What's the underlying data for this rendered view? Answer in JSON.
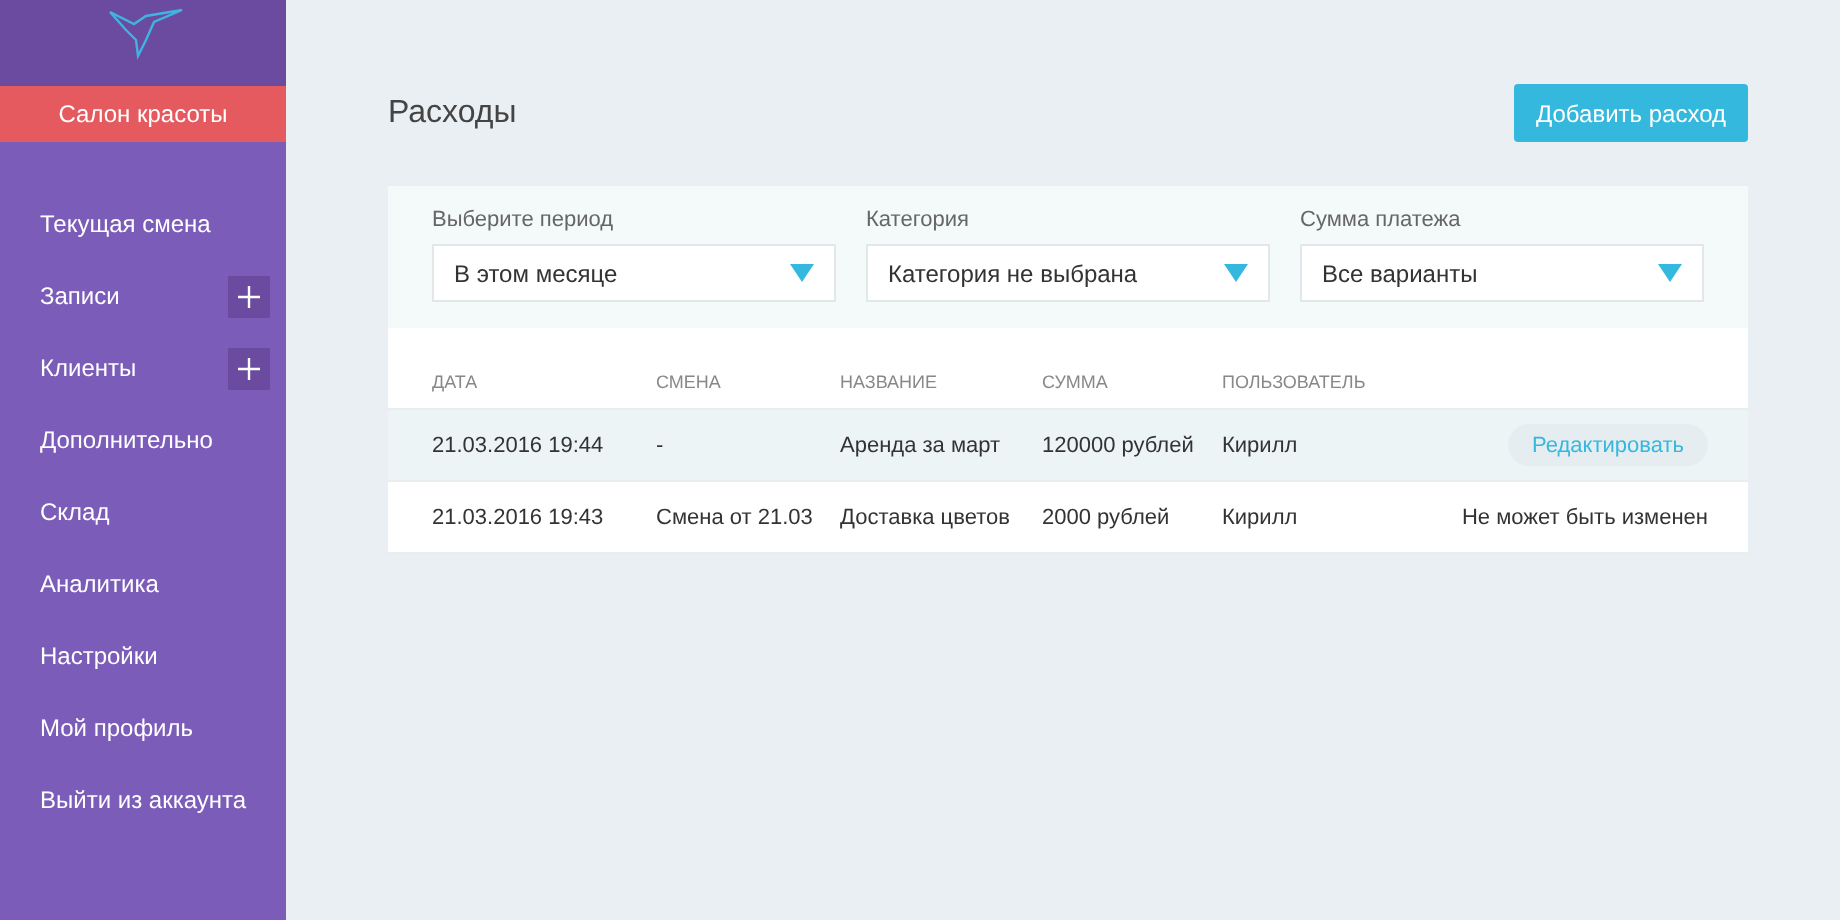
{
  "sidebar": {
    "brand": "Салон красоты",
    "items": [
      {
        "label": "Текущая смена",
        "kind": "link"
      },
      {
        "label": "Записи",
        "kind": "addable"
      },
      {
        "label": "Клиенты",
        "kind": "addable"
      },
      {
        "label": "Дополнительно",
        "kind": "link"
      },
      {
        "label": "Склад",
        "kind": "link"
      },
      {
        "label": "Аналитика",
        "kind": "link"
      },
      {
        "label": "Настройки",
        "kind": "link"
      },
      {
        "label": "Мой профиль",
        "kind": "link"
      },
      {
        "label": "Выйти из аккаунта",
        "kind": "link"
      }
    ]
  },
  "page": {
    "title": "Расходы",
    "add_button": "Добавить расход"
  },
  "filters": [
    {
      "label": "Выберите период",
      "value": "В этом месяце"
    },
    {
      "label": "Категория",
      "value": "Категория не выбрана"
    },
    {
      "label": "Сумма платежа",
      "value": "Все варианты"
    }
  ],
  "table": {
    "columns": [
      "ДАТА",
      "СМЕНА",
      "НАЗВАНИЕ",
      "СУММА",
      "ПОЛЬЗОВАТЕЛЬ"
    ],
    "rows": [
      {
        "cells": [
          "21.03.2016 19:44",
          "-",
          "Аренда за март",
          "120000 рублей",
          "Кирилл"
        ],
        "selected": true,
        "action": {
          "kind": "button",
          "label": "Редактировать"
        }
      },
      {
        "cells": [
          "21.03.2016 19:43",
          "Смена от 21.03",
          "Доставка цветов",
          "2000 рублей",
          "Кирилл"
        ],
        "selected": false,
        "action": {
          "kind": "text",
          "label": "Не может быть изменен"
        }
      }
    ]
  }
}
